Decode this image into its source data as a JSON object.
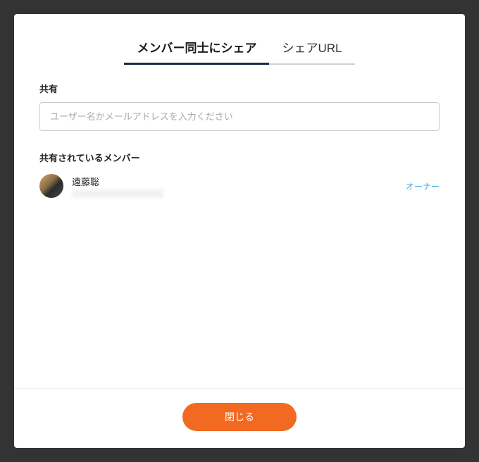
{
  "tabs": {
    "shareMembers": "メンバー同士にシェア",
    "shareUrl": "シェアURL"
  },
  "shareSection": {
    "label": "共有",
    "placeholder": "ユーザー名かメールアドレスを入力ください"
  },
  "membersSection": {
    "label": "共有されているメンバー",
    "members": [
      {
        "name": "遠藤聡",
        "role": "オーナー"
      }
    ]
  },
  "footer": {
    "closeLabel": "閉じる"
  }
}
